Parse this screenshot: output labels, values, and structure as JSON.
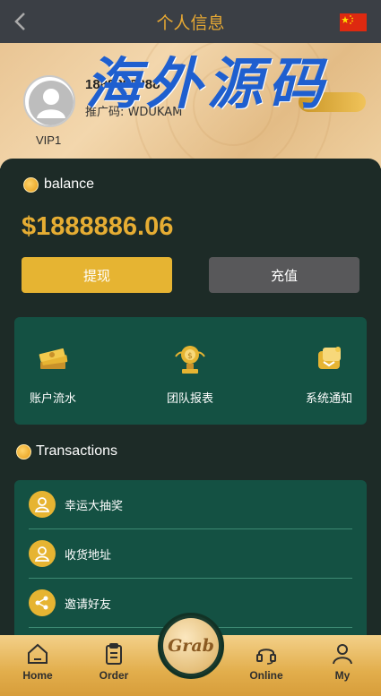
{
  "header": {
    "title": "个人信息",
    "back_icon": "chevron-left-icon",
    "flag_icon": "china-flag-icon"
  },
  "profile": {
    "username": "1888888888",
    "invite_code": "推广码: WDUKAM",
    "vip": "VIP1",
    "watermark": "海外源码"
  },
  "balance": {
    "label": "balance",
    "amount": "$1888886.06",
    "withdraw_label": "提现",
    "recharge_label": "充值"
  },
  "quick_actions": [
    {
      "label": "账户流水",
      "icon": "money-stack-icon"
    },
    {
      "label": "团队报表",
      "icon": "team-trophy-icon"
    },
    {
      "label": "系统通知",
      "icon": "notification-icon"
    }
  ],
  "transactions": {
    "label": "Transactions",
    "items": [
      {
        "label": "幸运大抽奖",
        "icon": "user-icon"
      },
      {
        "label": "收货地址",
        "icon": "user-icon"
      },
      {
        "label": "邀请好友",
        "icon": "share-icon"
      }
    ]
  },
  "tabbar": {
    "home": "Home",
    "order": "Order",
    "grab": "Grab",
    "online": "Online",
    "my": "My"
  },
  "colors": {
    "accent": "#e6ad33",
    "panel": "#145143",
    "background": "#1d2b27",
    "topbar": "#3b3f45"
  }
}
